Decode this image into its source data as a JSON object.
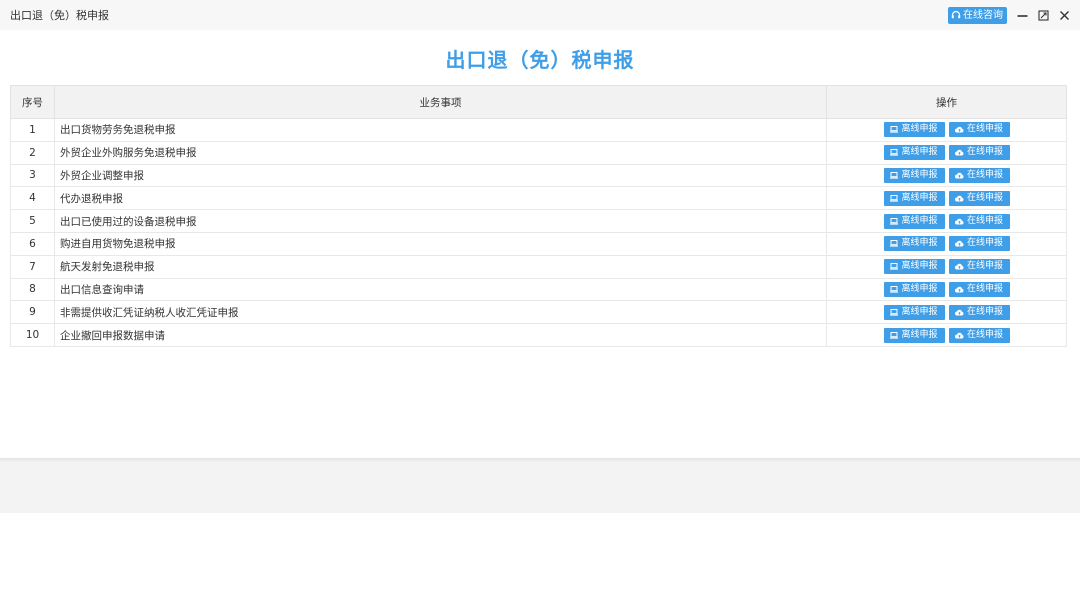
{
  "window": {
    "title": "出口退（免）税申报",
    "consult_label": "在线咨询",
    "icons": {
      "consult": "headset-icon",
      "minimize": "minimize-icon",
      "maximize": "maximize-icon",
      "close": "close-icon"
    }
  },
  "page": {
    "heading": "出口退（免）税申报"
  },
  "table": {
    "headers": [
      "序号",
      "业务事项",
      "操作"
    ],
    "offline_label": "离线申报",
    "online_label": "在线申报",
    "rows": [
      {
        "no": "1",
        "item": "出口货物劳务免退税申报"
      },
      {
        "no": "2",
        "item": "外贸企业外购服务免退税申报"
      },
      {
        "no": "3",
        "item": "外贸企业调整申报"
      },
      {
        "no": "4",
        "item": "代办退税申报"
      },
      {
        "no": "5",
        "item": "出口已使用过的设备退税申报"
      },
      {
        "no": "6",
        "item": "购进自用货物免退税申报"
      },
      {
        "no": "7",
        "item": "航天发射免退税申报"
      },
      {
        "no": "8",
        "item": "出口信息查询申请"
      },
      {
        "no": "9",
        "item": "非需提供收汇凭证纳税人收汇凭证申报"
      },
      {
        "no": "10",
        "item": "企业撤回申报数据申请"
      }
    ]
  },
  "colors": {
    "accent": "#3f9ee8",
    "header_bg": "#f2f2f2",
    "titlebar_bg": "#f7f7f7"
  }
}
